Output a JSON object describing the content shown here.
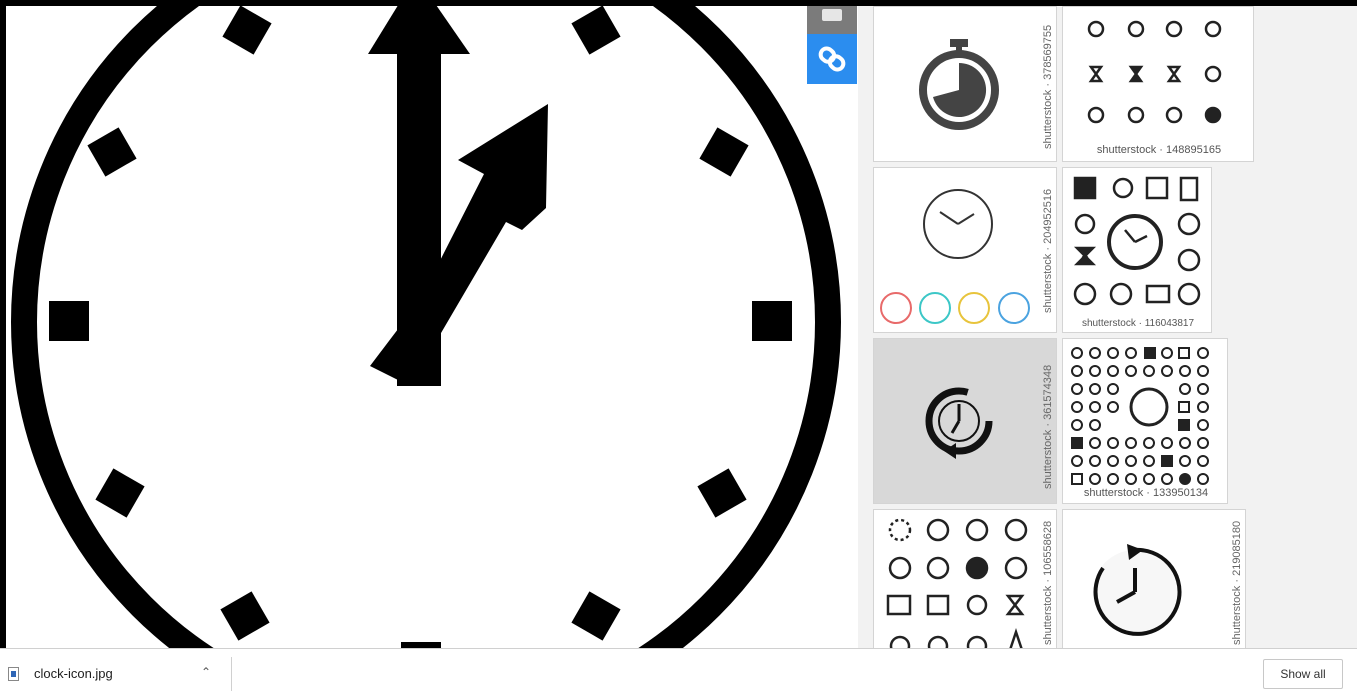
{
  "viewer": {
    "image_name": "clock-icon.jpg",
    "subject": "clock-icon"
  },
  "side_tools": [
    {
      "icon": "generic-icon",
      "color": "#7b7b7b"
    },
    {
      "icon": "link-icon",
      "color": "#2b8def"
    }
  ],
  "gallery": {
    "thumbnails": [
      {
        "credit": "shutterstock · 378569755",
        "icon": "stopwatch-icon"
      },
      {
        "credit": "shutterstock · 148895165",
        "icon": "clock-icon-set"
      },
      {
        "credit": "shutterstock · 204952516",
        "icon": "clock-icon"
      },
      {
        "credit": "shutterstock · 116043817",
        "icon": "clock-icon-set"
      },
      {
        "credit": "shutterstock · 361574348",
        "icon": "clock-refresh-icon"
      },
      {
        "credit": "shutterstock · 133950134",
        "icon": "clock-icon-set"
      },
      {
        "credit": "shutterstock · 106558628",
        "icon": "clock-icon-set"
      },
      {
        "credit": "shutterstock · 219085180",
        "icon": "clock-refresh-icon"
      }
    ]
  },
  "download_bar": {
    "file_name": "clock-icon.jpg",
    "show_all_label": "Show all"
  },
  "colors": {
    "accent_blue": "#2b8def",
    "clock_black": "#000000"
  }
}
